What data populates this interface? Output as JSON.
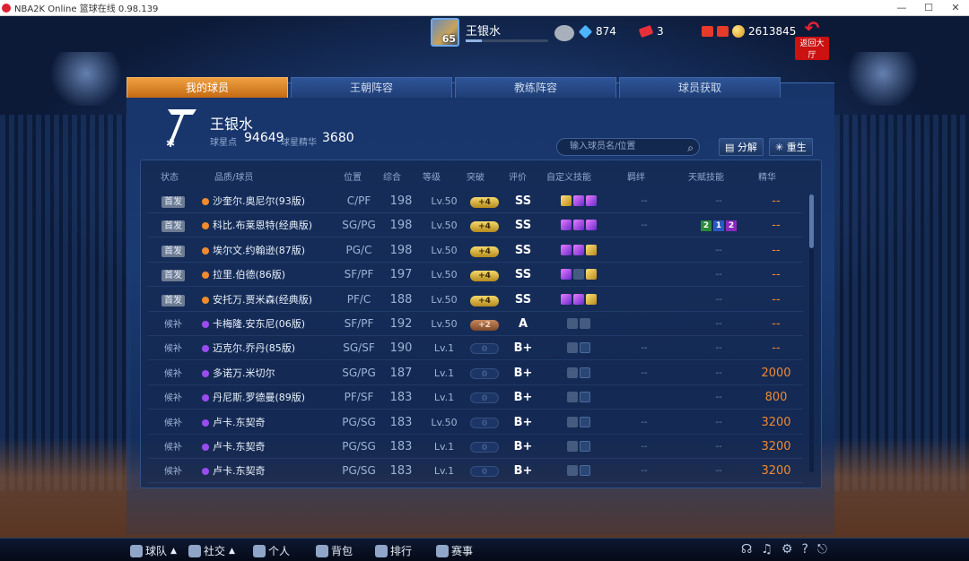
{
  "window": {
    "title": "NBA2K Online 篮球在线 0.98.139"
  },
  "topbar": {
    "player_name": "王银水",
    "level": "65",
    "gems": "874",
    "tickets": "3",
    "coins": "2613845",
    "back_label": "返回大厅"
  },
  "tabs": [
    "我的球员",
    "王朝阵容",
    "教练阵容",
    "球员获取"
  ],
  "team": {
    "name": "王银水",
    "stars_label": "球星点",
    "stars_value": "94649",
    "essence_label": "球星精华",
    "essence_value": "3680"
  },
  "search": {
    "placeholder": "输入球员名/位置"
  },
  "buttons": {
    "decompose": "分解",
    "reborn": "重生"
  },
  "headers": [
    "状态",
    "品质/球员",
    "位置",
    "综合",
    "等级",
    "突破",
    "评价",
    "自定义技能",
    "羁绊",
    "天赋技能",
    "精华"
  ],
  "rows": [
    {
      "status": "首发",
      "quality": "orange",
      "name": "沙奎尔.奥尼尔(93版)",
      "pos": "C/PF",
      "ovr": "198",
      "lv": "Lv.50",
      "brk": "+4",
      "brk_type": "gold",
      "grade": "SS",
      "skills": [
        "gd",
        "p",
        "p"
      ],
      "bond": "--",
      "talent": "--",
      "essence": "--"
    },
    {
      "status": "首发",
      "quality": "orange",
      "name": "科比.布莱恩特(经典版)",
      "pos": "SG/PG",
      "ovr": "198",
      "lv": "Lv.50",
      "brk": "+4",
      "brk_type": "gold",
      "grade": "SS",
      "skills": [
        "p",
        "p",
        "p"
      ],
      "bond": "--",
      "talent_vals": [
        "2",
        "1",
        "2"
      ],
      "essence": "--"
    },
    {
      "status": "首发",
      "quality": "orange",
      "name": "埃尔文.约翰逊(87版)",
      "pos": "PG/C",
      "ovr": "198",
      "lv": "Lv.50",
      "brk": "+4",
      "brk_type": "gold",
      "grade": "SS",
      "skills": [
        "p",
        "p",
        "gd"
      ],
      "bond": "",
      "talent": "--",
      "essence": "--"
    },
    {
      "status": "首发",
      "quality": "orange",
      "name": "拉里.伯德(86版)",
      "pos": "SF/PF",
      "ovr": "197",
      "lv": "Lv.50",
      "brk": "+4",
      "brk_type": "gold",
      "grade": "SS",
      "skills": [
        "p",
        "l",
        "gd"
      ],
      "bond": "",
      "talent": "--",
      "essence": "--"
    },
    {
      "status": "首发",
      "quality": "orange",
      "name": "安托万.贾米森(经典版)",
      "pos": "PF/C",
      "ovr": "188",
      "lv": "Lv.50",
      "brk": "+4",
      "brk_type": "gold",
      "grade": "SS",
      "skills": [
        "p",
        "p",
        "gd"
      ],
      "bond": "",
      "talent": "--",
      "essence": "--"
    },
    {
      "status": "候补",
      "quality": "purple",
      "name": "卡梅隆.安东尼(06版)",
      "pos": "SF/PF",
      "ovr": "192",
      "lv": "Lv.50",
      "brk": "+2",
      "brk_type": "copper",
      "grade": "A",
      "skills": [
        "l",
        "l"
      ],
      "bond": "",
      "talent": "--",
      "essence": "--"
    },
    {
      "status": "候补",
      "quality": "purple",
      "name": "迈克尔.乔丹(85版)",
      "pos": "SG/SF",
      "ovr": "190",
      "lv": "Lv.1",
      "brk": "0",
      "brk_type": "zero",
      "grade": "B+",
      "skills": [
        "l",
        "e"
      ],
      "bond": "--",
      "talent": "--",
      "essence": "--"
    },
    {
      "status": "候补",
      "quality": "purple",
      "name": "多诺万.米切尔",
      "pos": "SG/PG",
      "ovr": "187",
      "lv": "Lv.1",
      "brk": "0",
      "brk_type": "zero",
      "grade": "B+",
      "skills": [
        "l",
        "e"
      ],
      "bond": "--",
      "talent": "--",
      "essence": "2000"
    },
    {
      "status": "候补",
      "quality": "purple",
      "name": "丹尼斯.罗德曼(89版)",
      "pos": "PF/SF",
      "ovr": "183",
      "lv": "Lv.1",
      "brk": "0",
      "brk_type": "zero",
      "grade": "B+",
      "skills": [
        "l",
        "e"
      ],
      "bond": "",
      "talent": "--",
      "essence": "800"
    },
    {
      "status": "候补",
      "quality": "purple",
      "name": "卢卡.东契奇",
      "pos": "PG/SG",
      "ovr": "183",
      "lv": "Lv.50",
      "brk": "0",
      "brk_type": "zero",
      "grade": "B+",
      "skills": [
        "l",
        "e"
      ],
      "bond": "--",
      "talent": "--",
      "essence": "3200"
    },
    {
      "status": "候补",
      "quality": "purple",
      "name": "卢卡.东契奇",
      "pos": "PG/SG",
      "ovr": "183",
      "lv": "Lv.1",
      "brk": "0",
      "brk_type": "zero",
      "grade": "B+",
      "skills": [
        "l",
        "e"
      ],
      "bond": "--",
      "talent": "--",
      "essence": "3200"
    },
    {
      "status": "候补",
      "quality": "purple",
      "name": "卢卡.东契奇",
      "pos": "PG/SG",
      "ovr": "183",
      "lv": "Lv.1",
      "brk": "0",
      "brk_type": "zero",
      "grade": "B+",
      "skills": [
        "l",
        "e"
      ],
      "bond": "--",
      "talent": "--",
      "essence": "3200"
    }
  ],
  "bottom_nav": [
    "球队",
    "社交",
    "个人",
    "背包",
    "排行",
    "赛事"
  ],
  "colors": {
    "accent": "#f08a30",
    "orange_quality": "#f08a30",
    "purple_quality": "#9a4cf0"
  }
}
